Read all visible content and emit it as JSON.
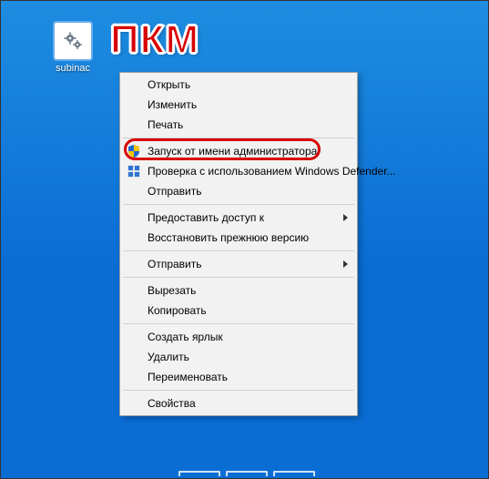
{
  "annotation": {
    "text": "ПКМ"
  },
  "desktop_icon": {
    "label": "subinac"
  },
  "menu": {
    "open": "Открыть",
    "edit": "Изменить",
    "print": "Печать",
    "run_as_admin": "Запуск от имени администратора",
    "defender": "Проверка с использованием Windows Defender...",
    "send_to": "Отправить",
    "share_access": "Предоставить доступ к",
    "restore_prev": "Восстановить прежнюю версию",
    "send_to_2": "Отправить",
    "cut": "Вырезать",
    "copy": "Копировать",
    "create_shortcut": "Создать ярлык",
    "delete": "Удалить",
    "rename": "Переименовать",
    "properties": "Свойства"
  }
}
